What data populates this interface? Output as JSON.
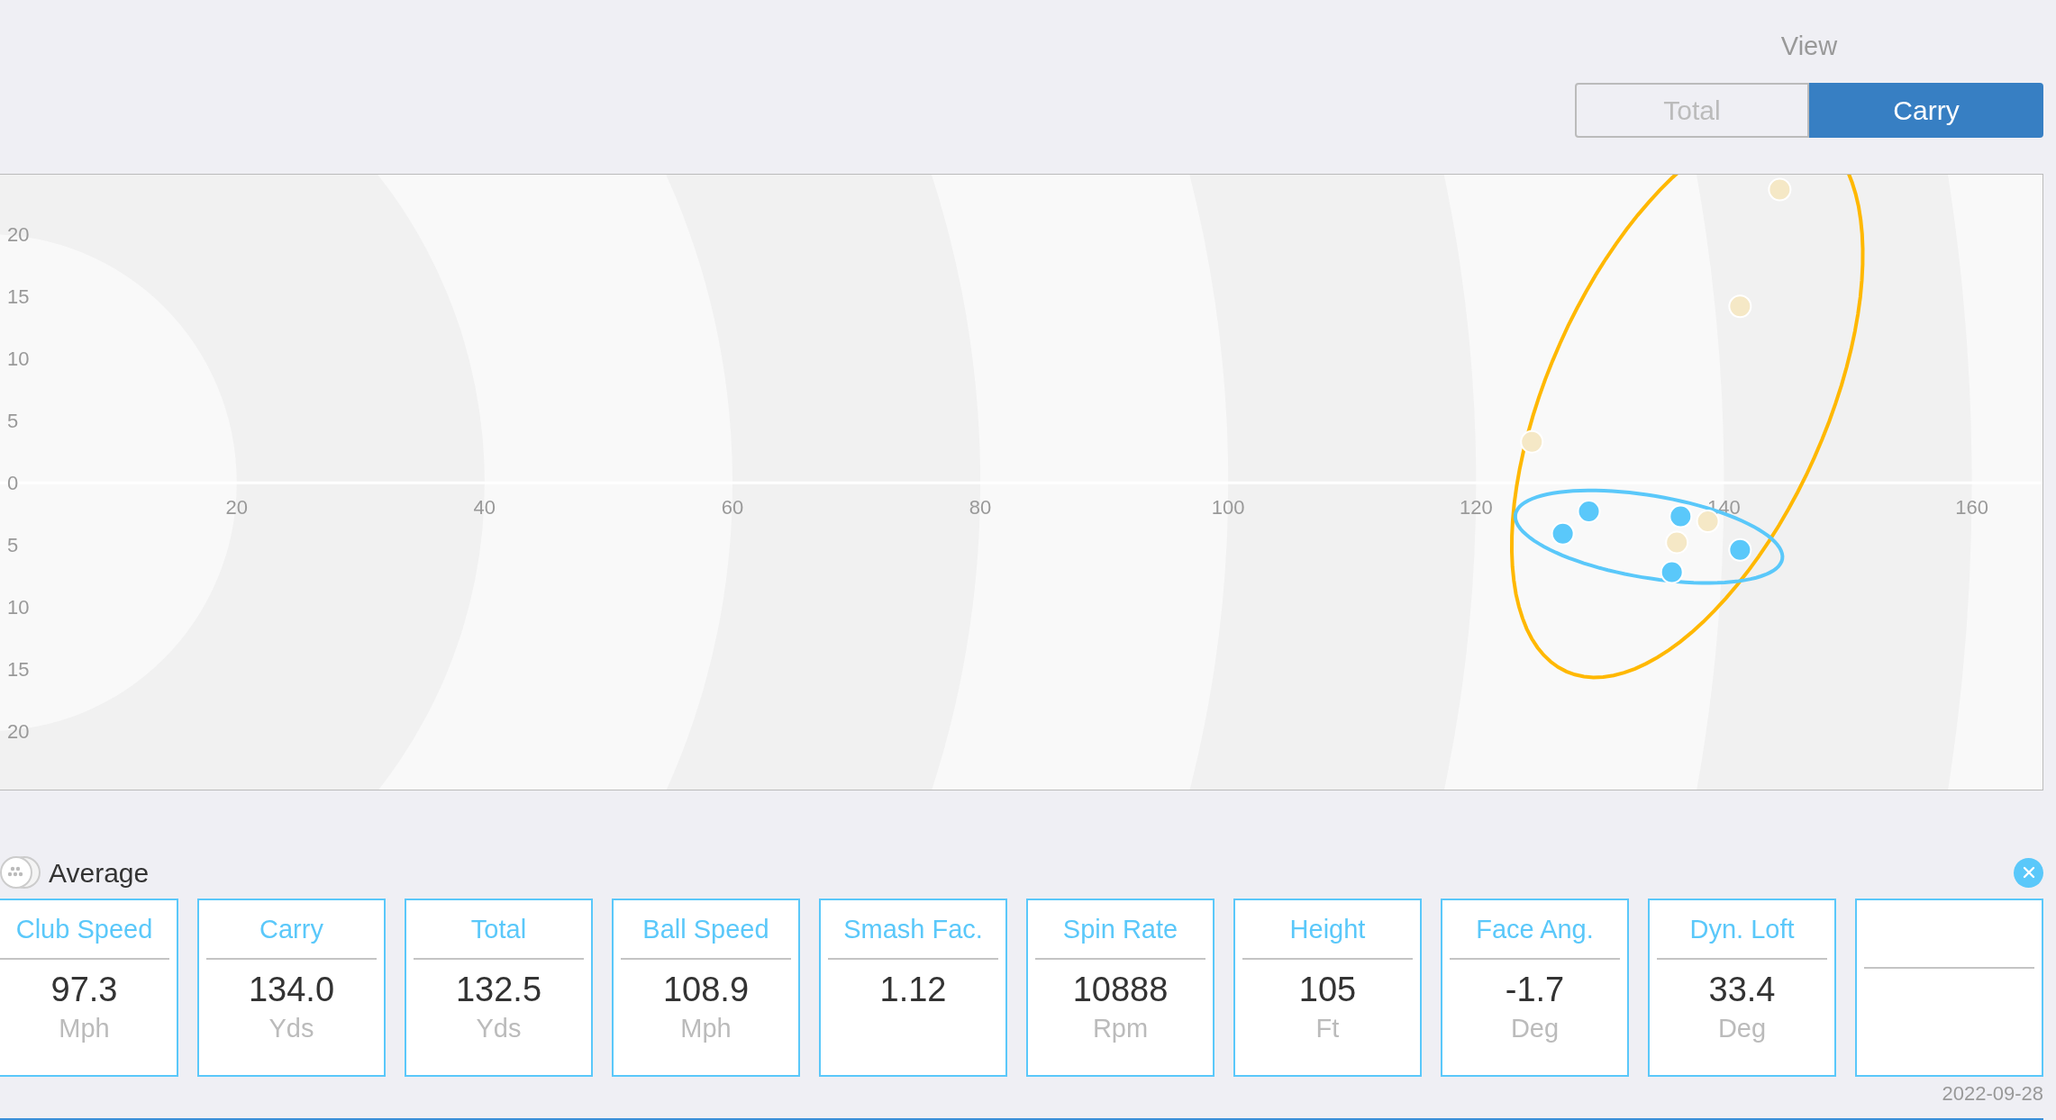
{
  "view": {
    "label": "View",
    "options": [
      {
        "label": "Total",
        "selected": false
      },
      {
        "label": "Carry",
        "selected": true
      }
    ]
  },
  "dispersion": {
    "chart_data": {
      "type": "scatter",
      "xlim": [
        0.9,
        165.7
      ],
      "ylim": [
        -24.7,
        24.8
      ],
      "xticks": [
        20,
        40,
        60,
        80,
        100,
        120,
        140,
        160
      ],
      "yticks": [
        {
          "value": -20,
          "label": "20"
        },
        {
          "value": -15,
          "label": "15"
        },
        {
          "value": -10,
          "label": "10"
        },
        {
          "value": -5,
          "label": "5"
        },
        {
          "value": 0,
          "label": "0"
        },
        {
          "value": 5,
          "label": "5"
        },
        {
          "value": 10,
          "label": "10"
        },
        {
          "value": 15,
          "label": "15"
        },
        {
          "value": 20,
          "label": "20"
        }
      ],
      "series": [
        {
          "color": "#f5e8c6",
          "x": [
            144.5,
            141.3,
            124.5,
            138.7,
            136.2
          ],
          "values": [
            23.6,
            14.2,
            3.3,
            -3.1,
            -4.8
          ]
        },
        {
          "color": "#5ac8fa",
          "x": [
            129.1,
            127.0,
            136.5,
            141.3,
            135.8
          ],
          "values": [
            -2.3,
            -4.1,
            -2.7,
            -5.4,
            -7.2
          ]
        }
      ]
    }
  },
  "average": {
    "label": "Average",
    "cards": [
      {
        "kind": "metric",
        "title": "Club Speed",
        "value": "97.3",
        "unit": "Mph"
      },
      {
        "kind": "metric",
        "title": "Carry",
        "value": "134.0",
        "unit": "Yds"
      },
      {
        "kind": "metric",
        "title": "Total",
        "value": "132.5",
        "unit": "Yds"
      },
      {
        "kind": "metric",
        "title": "Ball Speed",
        "value": "108.9",
        "unit": "Mph"
      },
      {
        "kind": "metric",
        "title": "Smash Fac.",
        "value": "1.12"
      },
      {
        "kind": "metric",
        "title": "Spin Rate",
        "value": "10888",
        "unit": "Rpm"
      },
      {
        "kind": "metric",
        "title": "Height",
        "value": "105",
        "unit": "Ft"
      },
      {
        "kind": "metric",
        "title": "Face Ang.",
        "value": "-1.7",
        "unit": "Deg"
      },
      {
        "kind": "metric",
        "title": "Dyn. Loft",
        "value": "33.4",
        "unit": "Deg"
      },
      {
        "kind": "blank"
      }
    ]
  },
  "date": "2022-09-28"
}
